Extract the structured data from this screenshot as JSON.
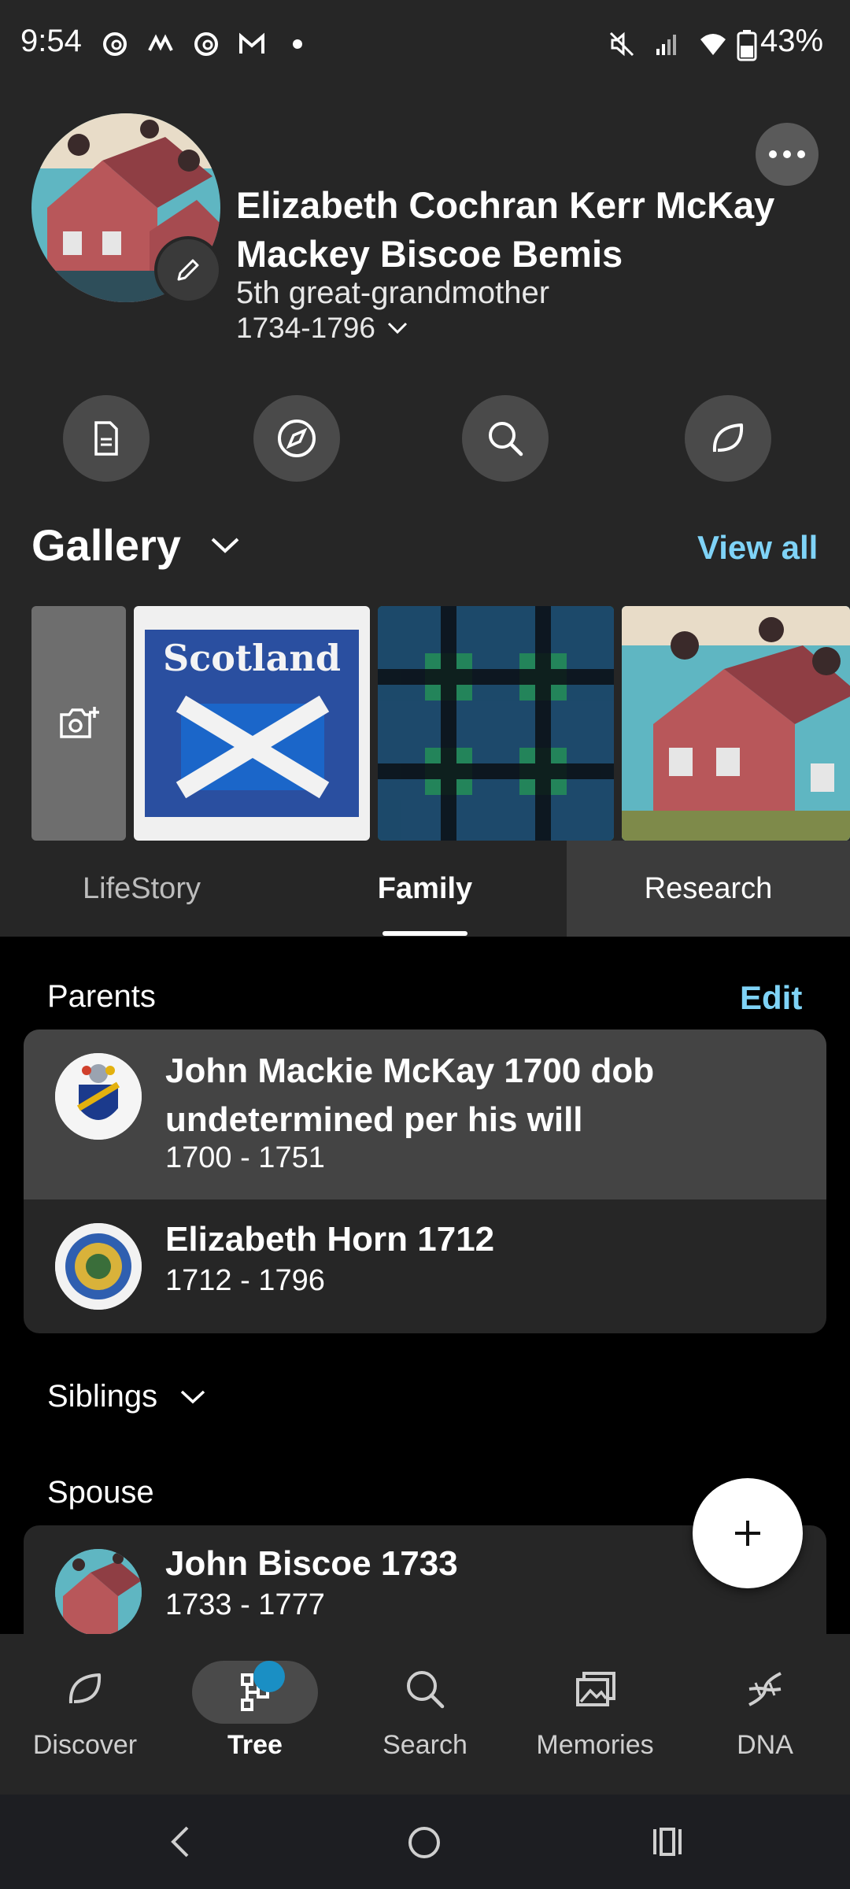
{
  "status_bar": {
    "time": "9:54",
    "battery": "43%",
    "left_icons": [
      "threads-icon",
      "messenger-icon",
      "threads-icon",
      "gmail-icon",
      "dot-icon"
    ],
    "right_icons": [
      "mute-icon",
      "signal-icon",
      "wifi-icon",
      "battery-icon"
    ]
  },
  "profile": {
    "name": "Elizabeth Cochran Kerr McKay Mackey Biscoe Bemis",
    "relation": "5th great-grandmother",
    "dates": "1734-1796"
  },
  "actions": [
    {
      "icon": "document-icon"
    },
    {
      "icon": "compass-icon"
    },
    {
      "icon": "search-icon"
    },
    {
      "icon": "leaf-icon"
    }
  ],
  "gallery": {
    "title": "Gallery",
    "view_all": "View all",
    "scotland_label": "Scotland"
  },
  "tabs": [
    {
      "label": "LifeStory",
      "active": false
    },
    {
      "label": "Family",
      "active": true
    },
    {
      "label": "Research",
      "active": false
    }
  ],
  "parents": {
    "label": "Parents",
    "edit": "Edit",
    "people": [
      {
        "name": "John Mackie McKay 1700 dob undetermined per his will",
        "dates": "1700 - 1751"
      },
      {
        "name": "Elizabeth Horn 1712",
        "dates": "1712 - 1796"
      }
    ]
  },
  "siblings": {
    "label": "Siblings"
  },
  "spouse": {
    "label": "Spouse",
    "people": [
      {
        "name": "John Biscoe 1733",
        "dates": "1733 - 1777"
      }
    ]
  },
  "bottom_nav": [
    {
      "label": "Discover",
      "icon": "leaf-icon",
      "active": false
    },
    {
      "label": "Tree",
      "icon": "tree-icon",
      "active": true
    },
    {
      "label": "Search",
      "icon": "search-icon",
      "active": false
    },
    {
      "label": "Memories",
      "icon": "photos-icon",
      "active": false
    },
    {
      "label": "DNA",
      "icon": "dna-icon",
      "active": false
    }
  ],
  "colors": {
    "accent": "#7fd3f7",
    "header_bg": "#262626",
    "page_bg": "#000000",
    "badge": "#1a8fc4"
  }
}
